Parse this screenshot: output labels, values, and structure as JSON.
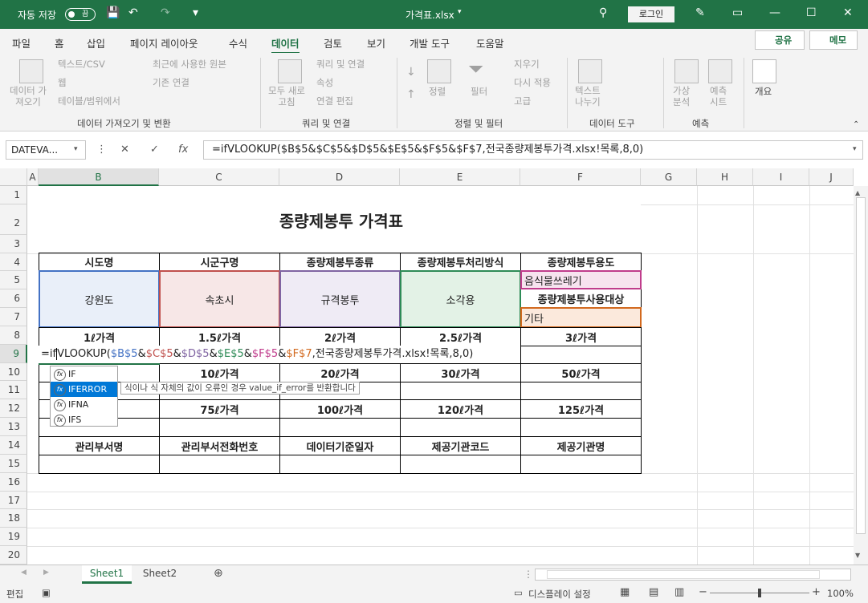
{
  "app": {
    "autosave": "자동 저장",
    "toggle": "끔",
    "filename": "가격표.xlsx",
    "login": "로그인"
  },
  "menu": [
    "파일",
    "홈",
    "삽입",
    "페이지 레이아웃",
    "수식",
    "데이터",
    "검토",
    "보기",
    "개발 도구",
    "도움말"
  ],
  "share": "공유",
  "memo": "메모",
  "ribbon": {
    "get_data": "데이터 가\n져오기",
    "text_csv": "텍스트/CSV",
    "web": "웹",
    "table_range": "테이블/범위에서",
    "recent": "최근에 사용한 원본",
    "existing": "기존 연결",
    "group1": "데이터 가져오기 및 변환",
    "refresh_all": "모두 새로\n고침",
    "queries": "쿼리 및 연결",
    "properties": "속성",
    "edit_links": "연결 편집",
    "group2": "쿼리 및 연결",
    "sort": "정렬",
    "filter": "필터",
    "clear": "지우기",
    "reapply": "다시 적용",
    "advanced": "고급",
    "group3": "정렬 및 필터",
    "text_to_col": "텍스트\n나누기",
    "group4": "데이터 도구",
    "whatif": "가상\n분석",
    "forecast_sheet": "예측\n시트",
    "group5": "예측",
    "outline": "개요"
  },
  "namebox": "DATEVA...",
  "formula": "=ifVLOOKUP($B$5&$C$5&$D$5&$E$5&$F$5&$F$7,전국종량제봉투가격.xlsx!목록,8,0)",
  "columns": [
    "A",
    "B",
    "C",
    "D",
    "E",
    "F",
    "G",
    "H",
    "I",
    "J"
  ],
  "rows": [
    "1",
    "2",
    "3",
    "4",
    "5",
    "6",
    "7",
    "8",
    "9",
    "10",
    "11",
    "12",
    "13",
    "14",
    "15",
    "16",
    "17",
    "18",
    "19",
    "20"
  ],
  "sheet_title": "종량제봉투 가격표",
  "headers4": [
    "시도명",
    "시군구명",
    "종량제봉투종류",
    "종량제봉투처리방식",
    "종량제봉투용도"
  ],
  "values5": [
    "강원도",
    "속초시",
    "규격봉투",
    "소각용",
    "음식물쓰레기"
  ],
  "f6": "종량제봉투사용대상",
  "f7": "기타",
  "row8": [
    "1ℓ가격",
    "1.5ℓ가격",
    "2ℓ가격",
    "2.5ℓ가격",
    "3ℓ가격"
  ],
  "row10": [
    "",
    "10ℓ가격",
    "20ℓ가격",
    "30ℓ가격",
    "50ℓ가격"
  ],
  "row12": [
    "",
    "75ℓ가격",
    "100ℓ가격",
    "120ℓ가격",
    "125ℓ가격"
  ],
  "row14": [
    "관리부서명",
    "관리부서전화번호",
    "데이터기준일자",
    "제공기관코드",
    "제공기관명"
  ],
  "edit": {
    "p1": "=if",
    "p2": "VLOOKUP(",
    "r1": "$B$5",
    "a1": "&",
    "r2": "$C$5",
    "a2": "&",
    "r3": "$D$5",
    "a3": "&",
    "r4": "$E$5",
    "a4": "&",
    "r5": "$F$5",
    "a5": "&",
    "r6": "$F$7",
    "tail": ",전국종량제봉투가격.xlsx!목록,8,0)"
  },
  "autocomplete": [
    "IF",
    "IFERROR",
    "IFNA",
    "IFS"
  ],
  "tooltip": "식이나 식 자체의 값이 오류인 경우 value_if_error를 반환합니다",
  "sheets": [
    "Sheet1",
    "Sheet2"
  ],
  "status": {
    "mode": "편집",
    "display": "디스플레이 설정",
    "zoom": "100%"
  },
  "colors": {
    "accent": "#217346",
    "blue": "#4472c4",
    "red": "#c0504d",
    "purple": "#8064a2",
    "green": "#2e8b57",
    "pink": "#c03c8c",
    "orange": "#d2691e"
  }
}
